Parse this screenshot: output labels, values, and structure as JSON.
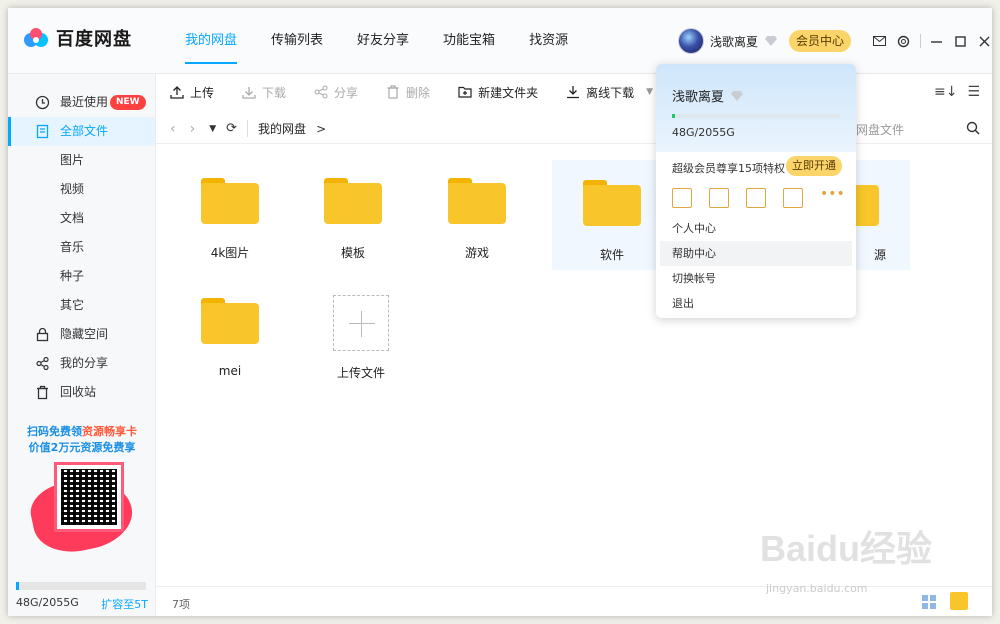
{
  "app": {
    "name": "百度网盘"
  },
  "topnav": [
    {
      "label": "我的网盘",
      "active": true
    },
    {
      "label": "传输列表"
    },
    {
      "label": "好友分享"
    },
    {
      "label": "功能宝箱"
    },
    {
      "label": "找资源"
    }
  ],
  "user": {
    "name": "浅歌离夏",
    "vip_button": "会员中心"
  },
  "sidebar": {
    "items": [
      {
        "label": "最近使用",
        "icon": "clock-icon",
        "badge": "NEW"
      },
      {
        "label": "全部文件",
        "icon": "document-icon",
        "active": true
      },
      {
        "label": "图片"
      },
      {
        "label": "视频"
      },
      {
        "label": "文档"
      },
      {
        "label": "音乐"
      },
      {
        "label": "种子"
      },
      {
        "label": "其它"
      },
      {
        "label": "隐藏空间",
        "icon": "lock-icon"
      },
      {
        "label": "我的分享",
        "icon": "share-icon"
      },
      {
        "label": "回收站",
        "icon": "trash-icon"
      }
    ],
    "promo": {
      "line1_a": "扫码免费领",
      "line1_b": "资源畅享卡",
      "line2": "价值2万元资源免费享"
    },
    "storage": {
      "used_text": "48G/2055G",
      "expand_label": "扩容至5T",
      "fraction": 0.02
    }
  },
  "toolbar": {
    "upload": "上传",
    "download": "下载",
    "share": "分享",
    "delete": "删除",
    "new_folder": "新建文件夹",
    "offline": "离线下载"
  },
  "path": {
    "current": "我的网盘",
    "sep": ">",
    "search_placeholder": "网盘文件"
  },
  "files": [
    {
      "name": "4k图片"
    },
    {
      "name": "模板"
    },
    {
      "name": "游戏"
    },
    {
      "name": "软件",
      "selected": true
    },
    {
      "name": "源",
      "selected": true
    },
    {
      "name": "mei"
    },
    {
      "name": "上传文件",
      "kind": "upload"
    }
  ],
  "footer": {
    "count": "7项"
  },
  "popover": {
    "name": "浅歌离夏",
    "quota": "48G/2055G",
    "quota_fraction": 0.02,
    "vip_text": "超级会员尊享15项特权",
    "vip_open": "立即开通",
    "menu": [
      "个人中心",
      "帮助中心",
      "切换帐号",
      "退出"
    ],
    "hovered_item": "帮助中心"
  },
  "watermark": {
    "brand": "Baidu经验",
    "url": "jingyan.baidu.com"
  },
  "colors": {
    "accent": "#06a7ff",
    "folder": "#f8c62a",
    "vip": "#fbd46a",
    "badge": "#ff4040"
  }
}
